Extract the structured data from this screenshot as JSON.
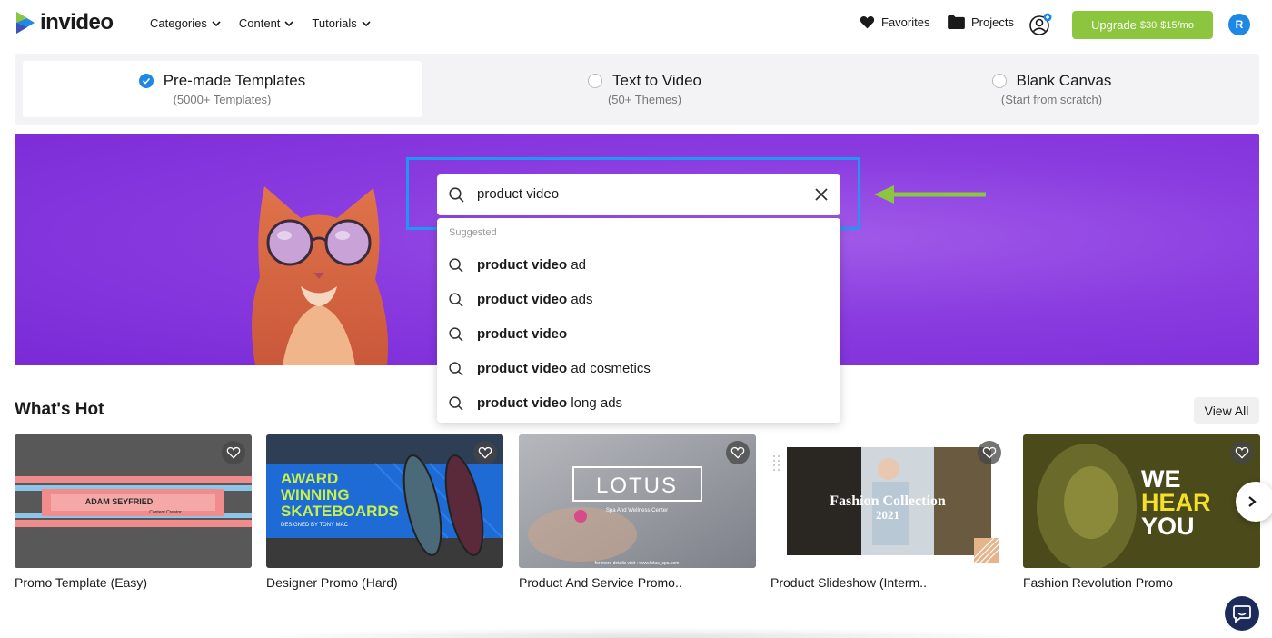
{
  "brand": {
    "name": "invideo",
    "accent": "#8cc63f",
    "blue": "#1e88e5",
    "hero_purple": "#8a3ce0"
  },
  "nav": [
    {
      "label": "Categories"
    },
    {
      "label": "Content"
    },
    {
      "label": "Tutorials"
    }
  ],
  "header": {
    "favorites_label": "Favorites",
    "projects_label": "Projects",
    "upgrade_label": "Upgrade",
    "upgrade_old_price": "$30",
    "upgrade_new_price": "$15/mo",
    "avatar_initial": "R"
  },
  "modes": [
    {
      "title": "Pre-made Templates",
      "subtitle": "(5000+ Templates)",
      "selected": true
    },
    {
      "title": "Text to Video",
      "subtitle": "(50+ Themes)",
      "selected": false
    },
    {
      "title": "Blank Canvas",
      "subtitle": "(Start from scratch)",
      "selected": false
    }
  ],
  "search": {
    "value": "product video",
    "suggested_label": "Suggested",
    "suggestions": [
      {
        "bold": "product video",
        "rest": " ad"
      },
      {
        "bold": "product video",
        "rest": " ads"
      },
      {
        "bold": "product video",
        "rest": ""
      },
      {
        "bold": "product video",
        "rest": " ad cosmetics"
      },
      {
        "bold": "product video",
        "rest": " long ads"
      }
    ]
  },
  "whats_hot": {
    "title": "What's Hot",
    "view_all_label": "View All",
    "cards": [
      {
        "title": "Promo Template (Easy)",
        "thumb_text": [
          "ADAM SEYFRIED",
          "Content Creator"
        ]
      },
      {
        "title": "Designer Promo (Hard)",
        "thumb_text": [
          "AWARD",
          "WINNING",
          "SKATEBOARDS",
          "DESIGNED BY TONY MAC"
        ]
      },
      {
        "title": "Product And Service Promo..",
        "thumb_text": [
          "LOTUS",
          "Spa And Wellness Center",
          "for more details visit : www.lotus_spa.com"
        ]
      },
      {
        "title": "Product Slideshow (Interm..",
        "thumb_text": [
          "Fashion Collection",
          "2021"
        ]
      },
      {
        "title": "Fashion Revolution Promo",
        "thumb_text": [
          "WE",
          "HEAR",
          "YOU"
        ]
      }
    ]
  }
}
